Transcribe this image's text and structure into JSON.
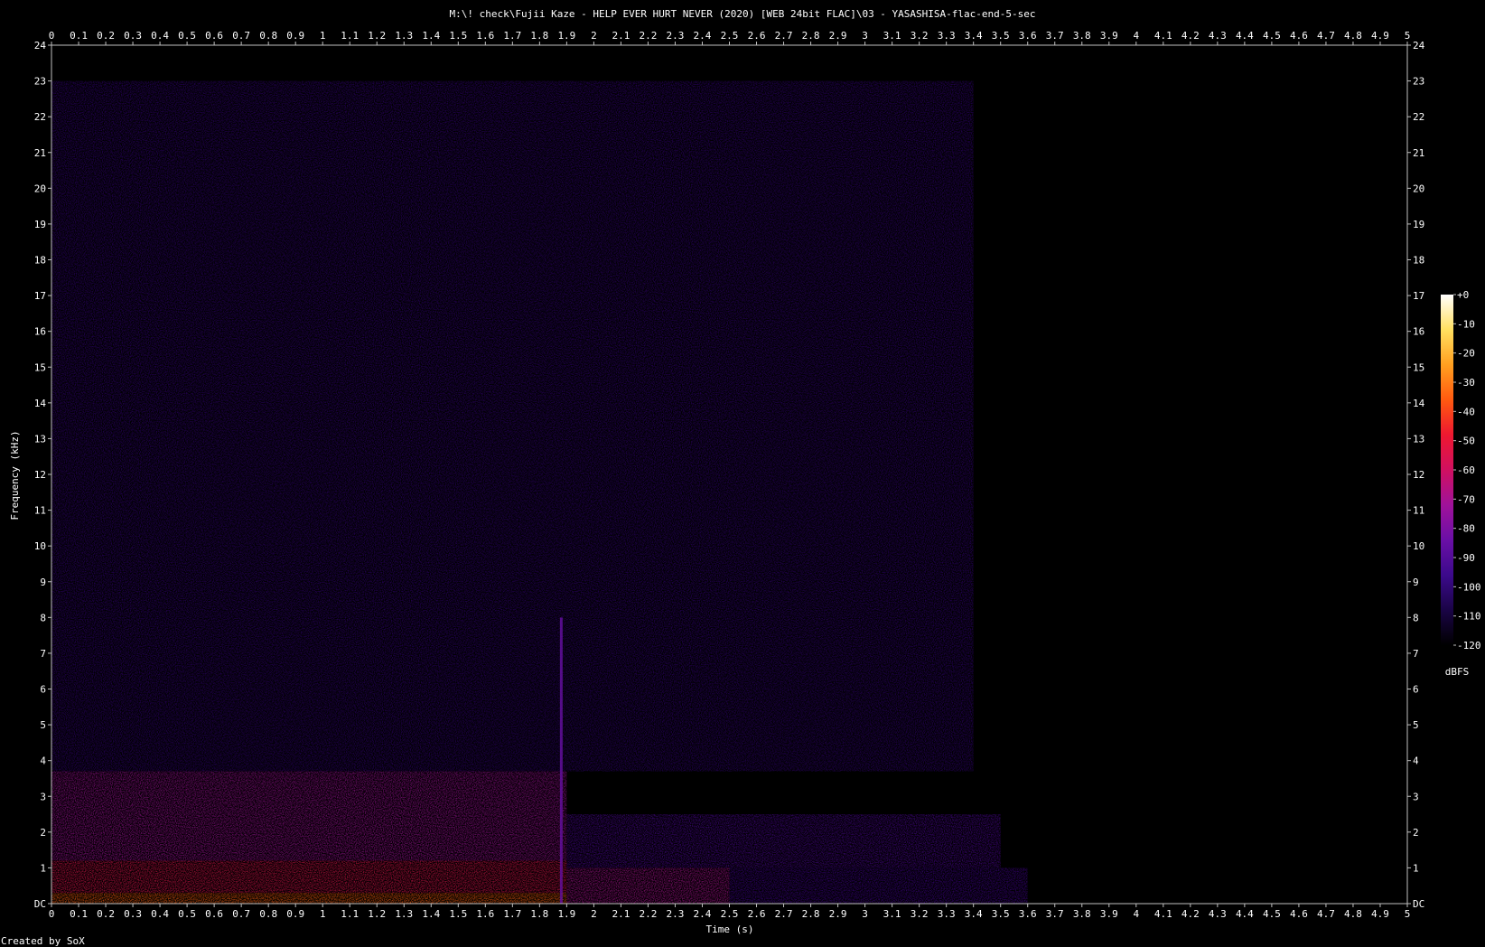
{
  "chart_data": {
    "type": "heatmap",
    "title": "M:\\! check\\Fujii Kaze - HELP EVER HURT NEVER (2020) [WEB 24bit FLAC]\\03 - YASASHISA-flac-end-5-sec",
    "xlabel": "Time (s)",
    "ylabel": "Frequency (kHz)",
    "xlim": [
      0,
      5
    ],
    "ylim": [
      0,
      24
    ],
    "x_ticks": [
      "0",
      "0.1",
      "0.2",
      "0.3",
      "0.4",
      "0.5",
      "0.6",
      "0.7",
      "0.8",
      "0.9",
      "1",
      "1.1",
      "1.2",
      "1.3",
      "1.4",
      "1.5",
      "1.6",
      "1.7",
      "1.8",
      "1.9",
      "2",
      "2.1",
      "2.2",
      "2.3",
      "2.4",
      "2.5",
      "2.6",
      "2.7",
      "2.8",
      "2.9",
      "3",
      "3.1",
      "3.2",
      "3.3",
      "3.4",
      "3.5",
      "3.6",
      "3.7",
      "3.8",
      "3.9",
      "4",
      "4.1",
      "4.2",
      "4.3",
      "4.4",
      "4.5",
      "4.6",
      "4.7",
      "4.8",
      "4.9",
      "5"
    ],
    "y_ticks": [
      "DC",
      "1",
      "2",
      "3",
      "4",
      "5",
      "6",
      "7",
      "8",
      "9",
      "10",
      "11",
      "12",
      "13",
      "14",
      "15",
      "16",
      "17",
      "18",
      "19",
      "20",
      "21",
      "22",
      "23",
      "24"
    ],
    "colorbar": {
      "label": "dBFS",
      "ticks": [
        "+0",
        "-10",
        "-20",
        "-30",
        "-40",
        "-50",
        "-60",
        "-70",
        "-80",
        "-90",
        "-100",
        "-110",
        "-120"
      ],
      "range": [
        -120,
        0
      ],
      "colors": [
        "#000000",
        "#1a0446",
        "#3c0a8c",
        "#6a0fa6",
        "#a0129a",
        "#d01060",
        "#ee1830",
        "#ff5a10",
        "#ffa020",
        "#ffe060",
        "#ffffff"
      ]
    },
    "regions": [
      {
        "t_start": 0,
        "t_end": 1.9,
        "f_low": 0,
        "f_high": 0.3,
        "level_db": -35
      },
      {
        "t_start": 0,
        "t_end": 1.9,
        "f_low": 0.3,
        "f_high": 1.2,
        "level_db": -55
      },
      {
        "t_start": 0,
        "t_end": 1.9,
        "f_low": 1.2,
        "f_high": 3.7,
        "level_db": -72
      },
      {
        "t_start": 0,
        "t_end": 3.4,
        "f_low": 3.7,
        "f_high": 23,
        "level_db": -100
      },
      {
        "t_start": 1.9,
        "t_end": 2.5,
        "f_low": 0,
        "f_high": 1.0,
        "level_db": -70
      },
      {
        "t_start": 1.9,
        "t_end": 3.5,
        "f_low": 1.0,
        "f_high": 2.5,
        "level_db": -92
      },
      {
        "t_start": 2.5,
        "t_end": 3.6,
        "f_low": 0,
        "f_high": 1.0,
        "level_db": -95
      },
      {
        "t_start": 3.6,
        "t_end": 5,
        "f_low": 0,
        "f_high": 24,
        "level_db": -120
      }
    ],
    "transients": [
      {
        "t": 1.88,
        "f_high": 8,
        "level_db": -85
      }
    ]
  },
  "footer": {
    "credit": "Created by SoX"
  }
}
